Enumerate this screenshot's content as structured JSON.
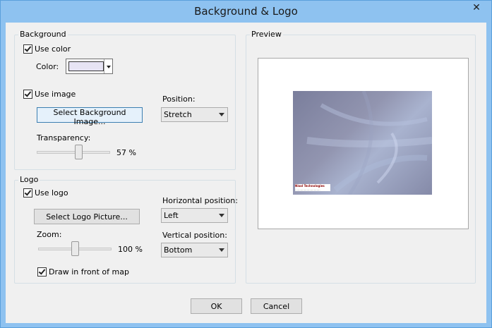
{
  "window": {
    "title": "Background & Logo",
    "close_glyph": "✕"
  },
  "background": {
    "group_label": "Background",
    "use_color_label": "Use color",
    "use_color_checked": true,
    "color_label": "Color:",
    "color_value": "#e7e4f4",
    "use_image_label": "Use image",
    "use_image_checked": true,
    "select_image_button": "Select Background Image...",
    "position_label": "Position:",
    "position_value": "Stretch",
    "transparency_label": "Transparency:",
    "transparency_value": 57,
    "transparency_text": "57 %"
  },
  "logo": {
    "group_label": "Logo",
    "use_logo_label": "Use logo",
    "use_logo_checked": true,
    "select_logo_button": "Select Logo Picture...",
    "horizontal_position_label": "Horizontal position:",
    "horizontal_position_value": "Left",
    "zoom_label": "Zoom:",
    "zoom_value": 100,
    "zoom_text": "100 %",
    "vertical_position_label": "Vertical position:",
    "vertical_position_value": "Bottom",
    "draw_in_front_label": "Draw in front of map",
    "draw_in_front_checked": true
  },
  "preview": {
    "group_label": "Preview",
    "logo_line1": "Nisol Technologies",
    "logo_line2": "............................"
  },
  "footer": {
    "ok_button": "OK",
    "cancel_button": "Cancel"
  },
  "icons": {
    "close": "close-icon",
    "checkbox": "check-icon",
    "dropdown": "chevron-down-icon"
  },
  "colors": {
    "titlebar": "#8ec2f0",
    "dialog_bg": "#f0f0f0"
  }
}
